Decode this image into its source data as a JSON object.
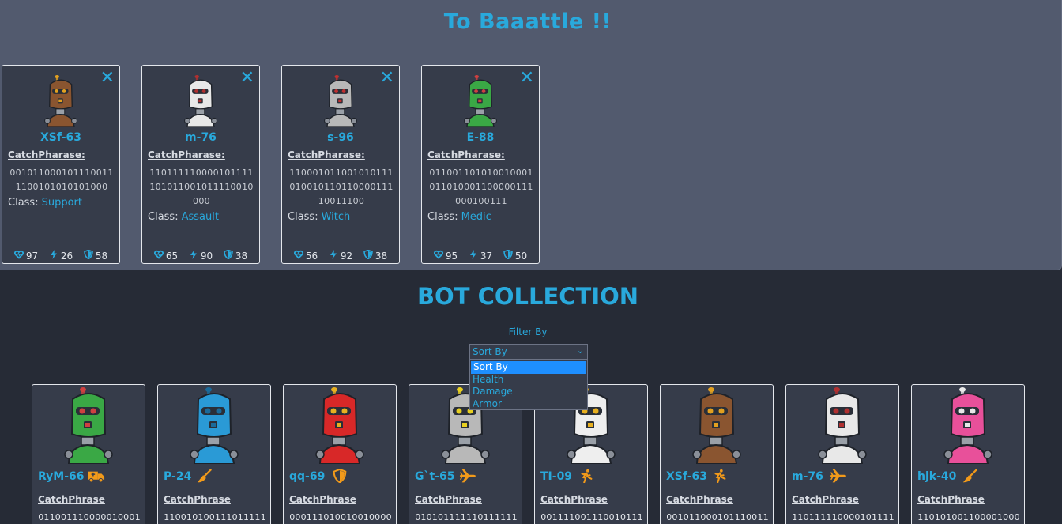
{
  "army": {
    "title": "To Baaattle !!",
    "close_glyph": "✕",
    "catchphrase_label": "CatchPharase:",
    "class_label": "Class:",
    "bots": [
      {
        "name": "XSf-63",
        "catchphrase": "0010110001011100111100101010101000",
        "class": "Support",
        "health": "97",
        "damage": "26",
        "armor": "58",
        "color": "#8a5530",
        "accent": "#e2a020"
      },
      {
        "name": "m-76",
        "catchphrase": "110111110000101111101011001011110010000",
        "class": "Assault",
        "health": "65",
        "damage": "90",
        "armor": "38",
        "color": "#e8e8e8",
        "accent": "#b03030"
      },
      {
        "name": "s-96",
        "catchphrase": "11000101100101011101001011011000011110011100",
        "class": "Witch",
        "health": "56",
        "damage": "92",
        "armor": "38",
        "color": "#b8b8b8",
        "accent": "#c03030"
      },
      {
        "name": "E-88",
        "catchphrase": "011001101010010001011010001100000111000100111",
        "class": "Medic",
        "health": "95",
        "damage": "37",
        "armor": "50",
        "color": "#3aa845",
        "accent": "#d04040"
      }
    ]
  },
  "collection": {
    "title": "BOT COLLECTION",
    "filter_label": "Filter By",
    "select_value": "Sort By",
    "options": [
      "Sort By",
      "Health",
      "Damage",
      "Armor"
    ],
    "catchphrase_label": "CatchPhrase",
    "bots": [
      {
        "name": "RyM-66",
        "catchphrase": "011001110000010001",
        "icon": "ambulance-icon",
        "color": "#3aa845",
        "accent": "#d04040"
      },
      {
        "name": "P-24",
        "catchphrase": "110010100111011111",
        "icon": "broom-icon",
        "color": "#2a9ad6",
        "accent": "#1a6a9a"
      },
      {
        "name": "qq-69",
        "catchphrase": "000111010010010000",
        "icon": "shield-icon",
        "color": "#d82828",
        "accent": "#e8b020"
      },
      {
        "name": "G`t-65",
        "catchphrase": "010101111110111111",
        "icon": "jet-icon",
        "color": "#b8b8b8",
        "accent": "#e8d020"
      },
      {
        "name": "TI-09",
        "catchphrase": "001111001110010111",
        "icon": "runner-icon",
        "color": "#eeeeee",
        "accent": "#e8b020"
      },
      {
        "name": "XSf-63",
        "catchphrase": "001011000101110011",
        "icon": "runner-icon",
        "color": "#8a5530",
        "accent": "#e2a020"
      },
      {
        "name": "m-76",
        "catchphrase": "110111110000101111",
        "icon": "jet-icon",
        "color": "#e8e8e8",
        "accent": "#b03030"
      },
      {
        "name": "hjk-40",
        "catchphrase": "110101001100001000",
        "icon": "broom-icon",
        "color": "#e8509a",
        "accent": "#e8e8e8"
      }
    ]
  },
  "colors": {
    "accent": "#29a9dc",
    "icon_orange": "#f29a1a",
    "army_bg": "#525a6e",
    "page_bg": "#262b36"
  }
}
